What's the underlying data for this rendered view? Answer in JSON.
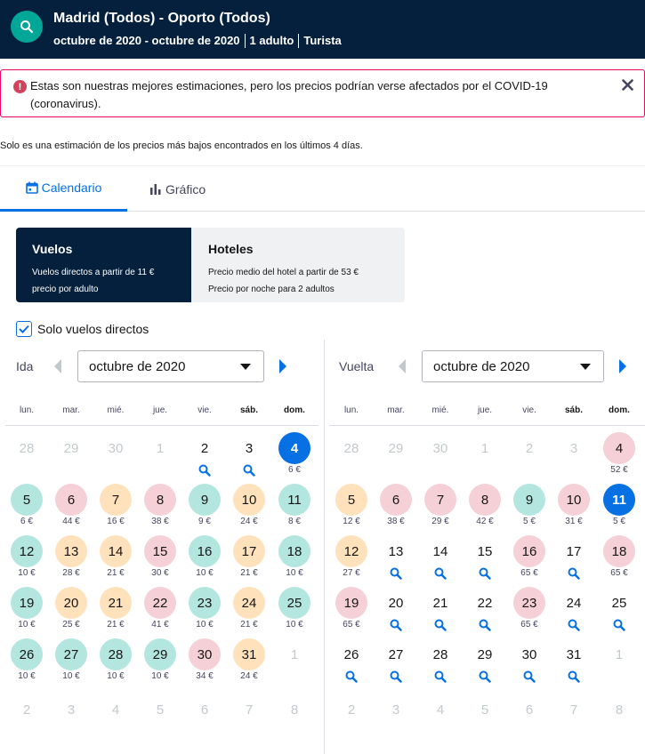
{
  "header": {
    "route": "Madrid (Todos) - Oporto (Todos)",
    "dates": "octubre de 2020 - octubre de 2020",
    "passengers": "1 adulto",
    "cabin": "Turista"
  },
  "alert": {
    "text": "Estas son nuestras mejores estimaciones, pero los precios podrían verse afectados por el COVID-19 (coronavirus)."
  },
  "note": "Solo es una estimación de los precios más bajos encontrados en los últimos 4 días.",
  "tabs": [
    {
      "label": "Calendario",
      "icon": "calendar-icon",
      "active": true
    },
    {
      "label": "Gráfico",
      "icon": "bar-chart-icon",
      "active": false
    }
  ],
  "modes": {
    "vuelos": {
      "title": "Vuelos",
      "line1": "Vuelos directos a partir de 11 €",
      "line2": "precio por adulto"
    },
    "hoteles": {
      "title": "Hoteles",
      "line1": "Precio medio del hotel a partir de 53 €",
      "line2": "Precio por noche para 2 adultos"
    }
  },
  "direct_filter": {
    "label": "Solo vuelos directos",
    "checked": true
  },
  "weekdays": [
    "lun.",
    "mar.",
    "mié.",
    "jue.",
    "vie.",
    "sáb.",
    "dom."
  ],
  "colors": {
    "green": "#b4e6e0",
    "orange": "#ffe2bc",
    "pink": "#f5d0d6",
    "selected": "#0770e3",
    "header": "#05203c"
  },
  "ida": {
    "label": "Ida",
    "month": "octubre de 2020",
    "days": [
      {
        "d": "28",
        "muted": true
      },
      {
        "d": "29",
        "muted": true
      },
      {
        "d": "30",
        "muted": true
      },
      {
        "d": "1",
        "muted": true
      },
      {
        "d": "2",
        "search": true
      },
      {
        "d": "3",
        "search": true
      },
      {
        "d": "4",
        "price": "6 €",
        "c": "sel"
      },
      {
        "d": "5",
        "price": "6 €",
        "c": "green"
      },
      {
        "d": "6",
        "price": "44 €",
        "c": "pink"
      },
      {
        "d": "7",
        "price": "16 €",
        "c": "orange"
      },
      {
        "d": "8",
        "price": "38 €",
        "c": "pink"
      },
      {
        "d": "9",
        "price": "9 €",
        "c": "green"
      },
      {
        "d": "10",
        "price": "24 €",
        "c": "orange"
      },
      {
        "d": "11",
        "price": "8 €",
        "c": "green"
      },
      {
        "d": "12",
        "price": "10 €",
        "c": "green"
      },
      {
        "d": "13",
        "price": "28 €",
        "c": "orange"
      },
      {
        "d": "14",
        "price": "21 €",
        "c": "orange"
      },
      {
        "d": "15",
        "price": "30 €",
        "c": "pink"
      },
      {
        "d": "16",
        "price": "10 €",
        "c": "green"
      },
      {
        "d": "17",
        "price": "21 €",
        "c": "orange"
      },
      {
        "d": "18",
        "price": "10 €",
        "c": "green"
      },
      {
        "d": "19",
        "price": "10 €",
        "c": "green"
      },
      {
        "d": "20",
        "price": "25 €",
        "c": "orange"
      },
      {
        "d": "21",
        "price": "21 €",
        "c": "orange"
      },
      {
        "d": "22",
        "price": "41 €",
        "c": "pink"
      },
      {
        "d": "23",
        "price": "10 €",
        "c": "green"
      },
      {
        "d": "24",
        "price": "21 €",
        "c": "orange"
      },
      {
        "d": "25",
        "price": "10 €",
        "c": "green"
      },
      {
        "d": "26",
        "price": "10 €",
        "c": "green"
      },
      {
        "d": "27",
        "price": "10 €",
        "c": "green"
      },
      {
        "d": "28",
        "price": "10 €",
        "c": "green"
      },
      {
        "d": "29",
        "price": "10 €",
        "c": "green"
      },
      {
        "d": "30",
        "price": "34 €",
        "c": "pink"
      },
      {
        "d": "31",
        "price": "24 €",
        "c": "orange"
      },
      {
        "d": "1",
        "muted": true
      },
      {
        "d": "2",
        "muted": true
      },
      {
        "d": "3",
        "muted": true
      },
      {
        "d": "4",
        "muted": true
      },
      {
        "d": "5",
        "muted": true
      },
      {
        "d": "6",
        "muted": true
      },
      {
        "d": "7",
        "muted": true
      },
      {
        "d": "8",
        "muted": true
      }
    ]
  },
  "vuelta": {
    "label": "Vuelta",
    "month": "octubre de 2020",
    "days": [
      {
        "d": "28",
        "muted": true
      },
      {
        "d": "29",
        "muted": true
      },
      {
        "d": "30",
        "muted": true
      },
      {
        "d": "1",
        "muted": true
      },
      {
        "d": "2",
        "muted": true
      },
      {
        "d": "3",
        "muted": true
      },
      {
        "d": "4",
        "price": "52 €",
        "c": "pink"
      },
      {
        "d": "5",
        "price": "12 €",
        "c": "orange"
      },
      {
        "d": "6",
        "price": "38 €",
        "c": "pink"
      },
      {
        "d": "7",
        "price": "29 €",
        "c": "pink"
      },
      {
        "d": "8",
        "price": "42 €",
        "c": "pink"
      },
      {
        "d": "9",
        "price": "5 €",
        "c": "green"
      },
      {
        "d": "10",
        "price": "31 €",
        "c": "pink"
      },
      {
        "d": "11",
        "price": "5 €",
        "c": "sel"
      },
      {
        "d": "12",
        "price": "27 €",
        "c": "orange"
      },
      {
        "d": "13",
        "search": true
      },
      {
        "d": "14",
        "search": true
      },
      {
        "d": "15",
        "search": true
      },
      {
        "d": "16",
        "price": "65 €",
        "c": "pink"
      },
      {
        "d": "17",
        "search": true
      },
      {
        "d": "18",
        "price": "65 €",
        "c": "pink"
      },
      {
        "d": "19",
        "price": "65 €",
        "c": "pink"
      },
      {
        "d": "20",
        "search": true
      },
      {
        "d": "21",
        "search": true
      },
      {
        "d": "22",
        "search": true
      },
      {
        "d": "23",
        "price": "65 €",
        "c": "pink"
      },
      {
        "d": "24",
        "search": true
      },
      {
        "d": "25",
        "search": true
      },
      {
        "d": "26",
        "search": true
      },
      {
        "d": "27",
        "search": true
      },
      {
        "d": "28",
        "search": true
      },
      {
        "d": "29",
        "search": true
      },
      {
        "d": "30",
        "search": true
      },
      {
        "d": "31",
        "search": true
      },
      {
        "d": "1",
        "muted": true
      },
      {
        "d": "2",
        "muted": true
      },
      {
        "d": "3",
        "muted": true
      },
      {
        "d": "4",
        "muted": true
      },
      {
        "d": "5",
        "muted": true
      },
      {
        "d": "6",
        "muted": true
      },
      {
        "d": "7",
        "muted": true
      },
      {
        "d": "8",
        "muted": true
      }
    ]
  }
}
